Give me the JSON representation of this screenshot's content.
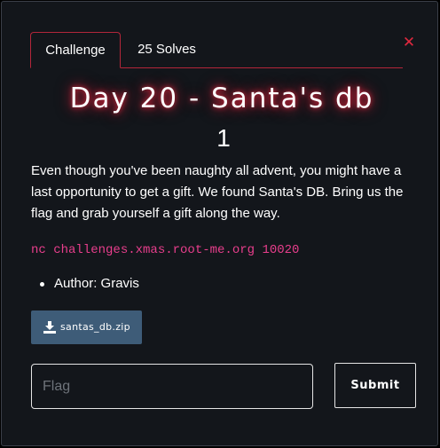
{
  "tabs": [
    {
      "label": "Challenge",
      "active": true
    },
    {
      "label": "25 Solves",
      "active": false
    }
  ],
  "close_symbol": "✕",
  "challenge": {
    "title": "Day 20 - Santa's db",
    "value": "1",
    "description": "Even though you've been naughty all advent, you might have a last opportunity to get a gift. We found Santa's DB. Bring us the flag and grab yourself a gift along the way.",
    "command": "nc challenges.xmas.root-me.org 10020",
    "author": "Author: Gravis"
  },
  "file": {
    "name": "santas_db.zip",
    "icon": "download-icon"
  },
  "flag_form": {
    "placeholder": "Flag",
    "value": "",
    "submit_label": "Submit"
  },
  "colors": {
    "accent": "#b3263a",
    "close": "#e0283e",
    "command": "#e83e8c",
    "file_button": "#3e5c78",
    "background": "#13161b"
  }
}
